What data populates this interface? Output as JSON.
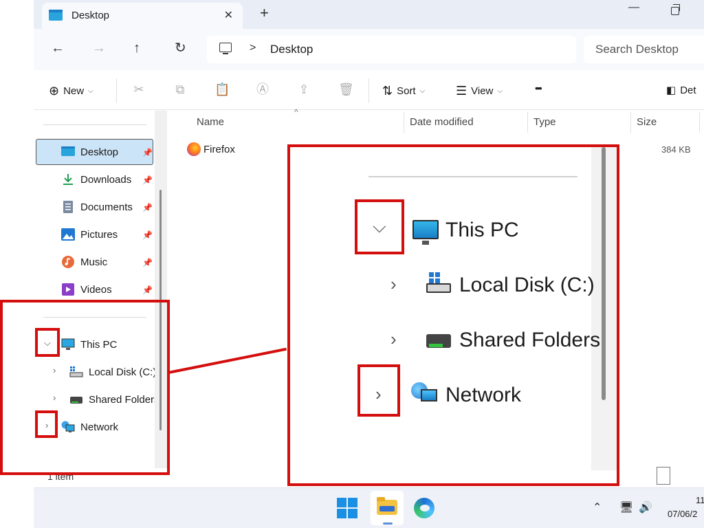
{
  "window": {
    "tab_title": "Desktop",
    "close_glyph": "✕",
    "new_tab_glyph": "+",
    "minimize_glyph": "—"
  },
  "nav": {
    "back_glyph": "←",
    "forward_glyph": "→",
    "up_glyph": "↑",
    "refresh_glyph": "↻",
    "address_sep": ">",
    "address_text": "Desktop",
    "search_placeholder": "Search Desktop"
  },
  "commands": {
    "new_label": "New",
    "sort_label": "Sort",
    "view_label": "View",
    "more_glyph": "•••",
    "details_label": "Det"
  },
  "sidebar": {
    "quick_access": [
      {
        "label": "Desktop",
        "icon": "desktop-icon"
      },
      {
        "label": "Downloads",
        "icon": "download-icon"
      },
      {
        "label": "Documents",
        "icon": "documents-icon"
      },
      {
        "label": "Pictures",
        "icon": "pictures-icon"
      },
      {
        "label": "Music",
        "icon": "music-icon"
      },
      {
        "label": "Videos",
        "icon": "videos-icon"
      }
    ],
    "this_pc": "This PC",
    "local_disk": "Local Disk (C:)",
    "shared_folders": "Shared Folders",
    "network": "Network"
  },
  "columns": {
    "name": "Name",
    "date_modified": "Date modified",
    "type": "Type",
    "size": "Size"
  },
  "files": [
    {
      "name": "Firefox",
      "size": "384 KB",
      "icon": "firefox-icon"
    }
  ],
  "status": {
    "item_count": "1 item"
  },
  "taskbar": {
    "time": "11",
    "date": "07/06/2"
  },
  "callout": {
    "this_pc": "This PC",
    "local_disk": "Local Disk (C:)",
    "shared_folders": "Shared Folders",
    "network": "Network"
  },
  "colors": {
    "annotation_red": "#d40d0d",
    "selection_blue": "#cce4f7",
    "titlebar": "#e9eef6"
  }
}
